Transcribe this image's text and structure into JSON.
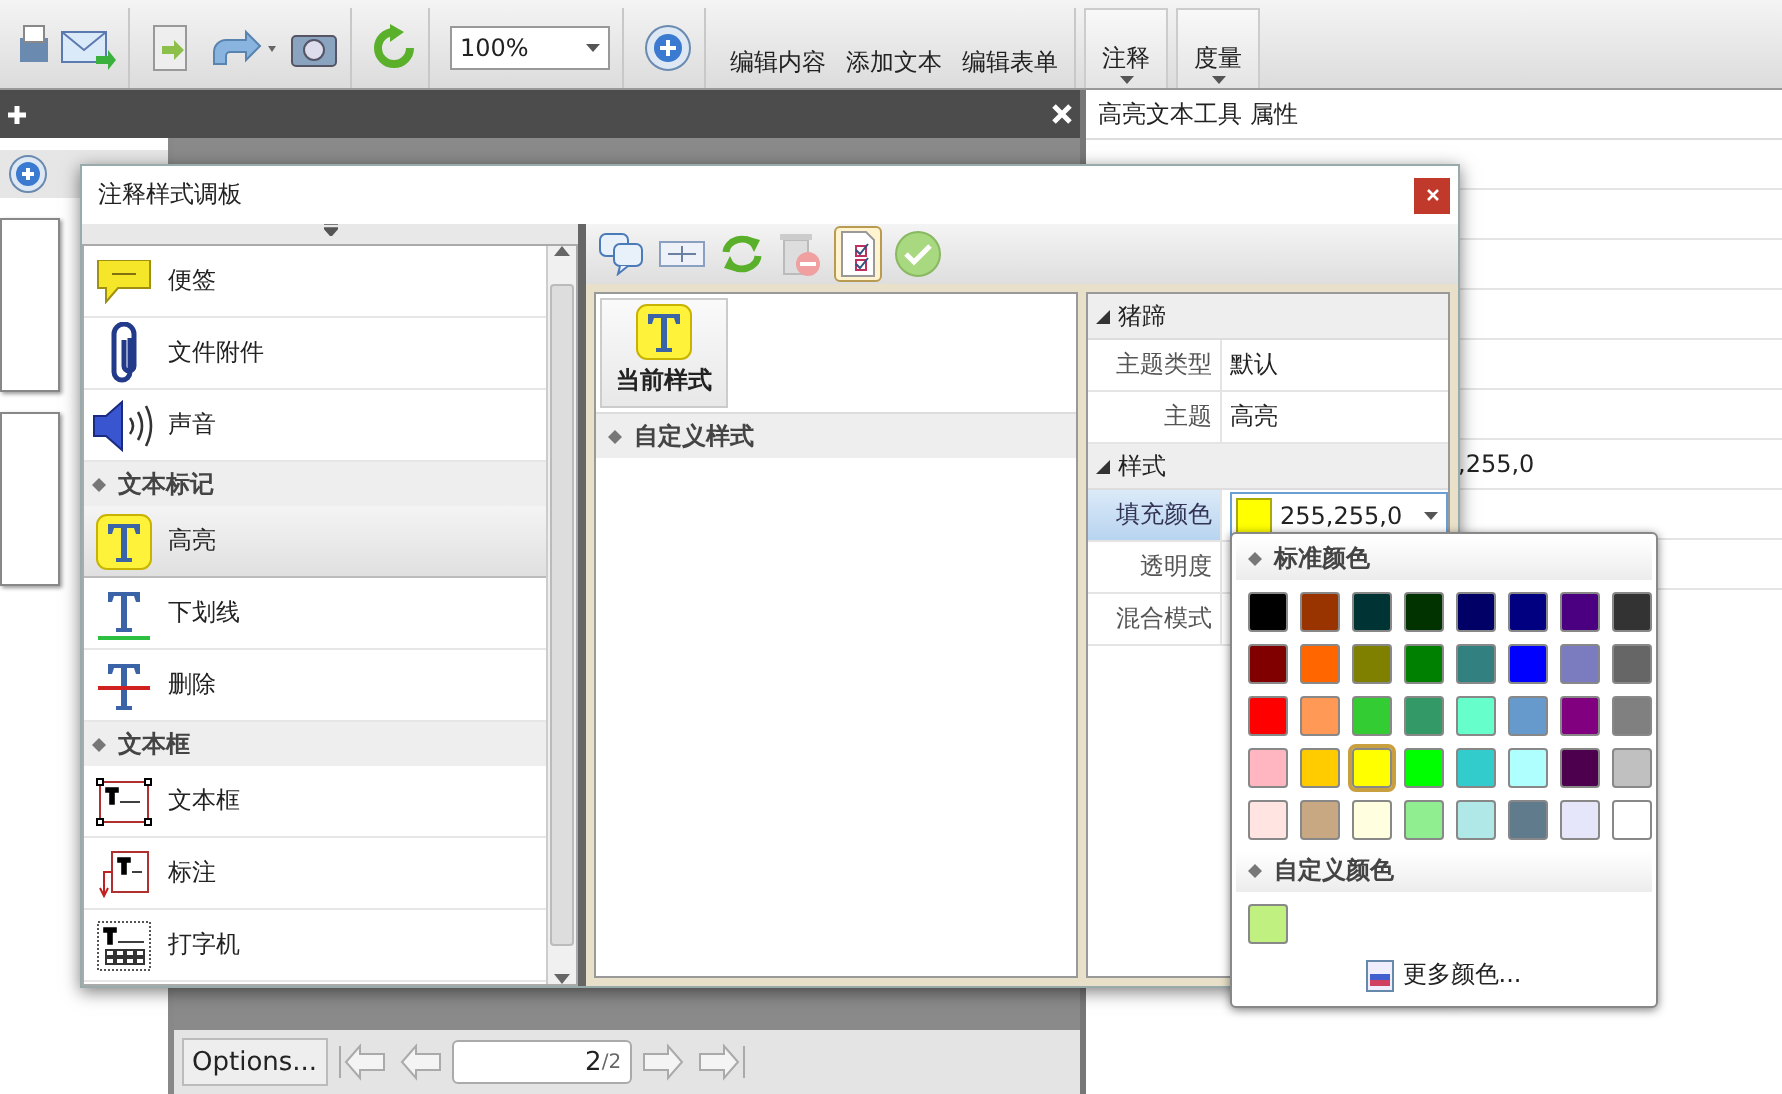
{
  "toolbar": {
    "zoom_field": "100%",
    "buttons": [
      {
        "label": "编辑内容"
      },
      {
        "label": "添加文本"
      },
      {
        "label": "编辑表单"
      }
    ],
    "menus": [
      {
        "label": "注释"
      },
      {
        "label": "度量"
      }
    ]
  },
  "properties_panel": {
    "title": "高亮文本工具 属性",
    "visible_value": ",255,0"
  },
  "bottom_bar": {
    "options_dropdown": "Options...",
    "page_field": "2",
    "page_total": "/2"
  },
  "dialog": {
    "title": "注释样式调板",
    "style_list": [
      {
        "kind": "note",
        "label": "便签",
        "selected": false
      },
      {
        "kind": "attachment",
        "label": "文件附件",
        "selected": false
      },
      {
        "kind": "sound",
        "label": "声音",
        "selected": false
      },
      {
        "kind": "header",
        "label": "文本标记"
      },
      {
        "kind": "highlight",
        "label": "高亮",
        "selected": true
      },
      {
        "kind": "underline",
        "label": "下划线",
        "selected": false
      },
      {
        "kind": "strikeout",
        "label": "删除",
        "selected": false
      },
      {
        "kind": "header",
        "label": "文本框"
      },
      {
        "kind": "textbox",
        "label": "文本框",
        "selected": false
      },
      {
        "kind": "callout",
        "label": "标注",
        "selected": false
      },
      {
        "kind": "typewriter",
        "label": "打字机",
        "selected": false
      }
    ],
    "current_style": {
      "label": "当前样式"
    },
    "custom_styles": {
      "label": "自定义样式"
    },
    "property_groups": [
      {
        "label": "猪蹄",
        "expanded": true,
        "rows": [
          {
            "name": "主题类型",
            "value": "默认",
            "selected": false
          },
          {
            "name": "主题",
            "value": "高亮",
            "selected": false
          }
        ]
      },
      {
        "label": "样式",
        "expanded": true,
        "rows": [
          {
            "name": "填充颜色",
            "value": "255,255,0",
            "color": "#ffff00",
            "selected": true
          },
          {
            "name": "透明度",
            "selected": false
          },
          {
            "name": "混合模式",
            "selected": false
          }
        ]
      }
    ]
  },
  "color_popup": {
    "standard_title": "标准颜色",
    "standard_colors": [
      {
        "color": "#000000",
        "selected": false
      },
      {
        "color": "#993300",
        "selected": false
      },
      {
        "color": "#003333",
        "selected": false
      },
      {
        "color": "#003300",
        "selected": false
      },
      {
        "color": "#000066",
        "selected": false
      },
      {
        "color": "#000080",
        "selected": false
      },
      {
        "color": "#4b0082",
        "selected": false
      },
      {
        "color": "#333333",
        "selected": false
      },
      {
        "color": "#800000",
        "selected": false
      },
      {
        "color": "#ff6600",
        "selected": false
      },
      {
        "color": "#808000",
        "selected": false
      },
      {
        "color": "#008000",
        "selected": false
      },
      {
        "color": "#338080",
        "selected": false
      },
      {
        "color": "#0000ff",
        "selected": false
      },
      {
        "color": "#7b7bc0",
        "selected": false
      },
      {
        "color": "#666666",
        "selected": false
      },
      {
        "color": "#ff0000",
        "selected": false
      },
      {
        "color": "#ff9955",
        "selected": false
      },
      {
        "color": "#33cc33",
        "selected": false
      },
      {
        "color": "#339966",
        "selected": false
      },
      {
        "color": "#66ffcc",
        "selected": false
      },
      {
        "color": "#6699cc",
        "selected": false
      },
      {
        "color": "#800080",
        "selected": false
      },
      {
        "color": "#808080",
        "selected": false
      },
      {
        "color": "#ffb6c1",
        "selected": false
      },
      {
        "color": "#ffcc00",
        "selected": false
      },
      {
        "color": "#ffff00",
        "selected": true
      },
      {
        "color": "#00ff00",
        "selected": false
      },
      {
        "color": "#33cccc",
        "selected": false
      },
      {
        "color": "#b0ffff",
        "selected": false
      },
      {
        "color": "#4d004d",
        "selected": false
      },
      {
        "color": "#c0c0c0",
        "selected": false
      },
      {
        "color": "#ffe4e1",
        "selected": false
      },
      {
        "color": "#c8a882",
        "selected": false
      },
      {
        "color": "#ffffe0",
        "selected": false
      },
      {
        "color": "#90ee90",
        "selected": false
      },
      {
        "color": "#b0e8e8",
        "selected": false
      },
      {
        "color": "#607b8b",
        "selected": false
      },
      {
        "color": "#e6e6fa",
        "selected": false
      },
      {
        "color": "#ffffff",
        "selected": false
      }
    ],
    "custom_title": "自定义颜色",
    "custom_colors": [
      {
        "color": "#c0f080"
      }
    ],
    "more_button": "更多颜色..."
  }
}
